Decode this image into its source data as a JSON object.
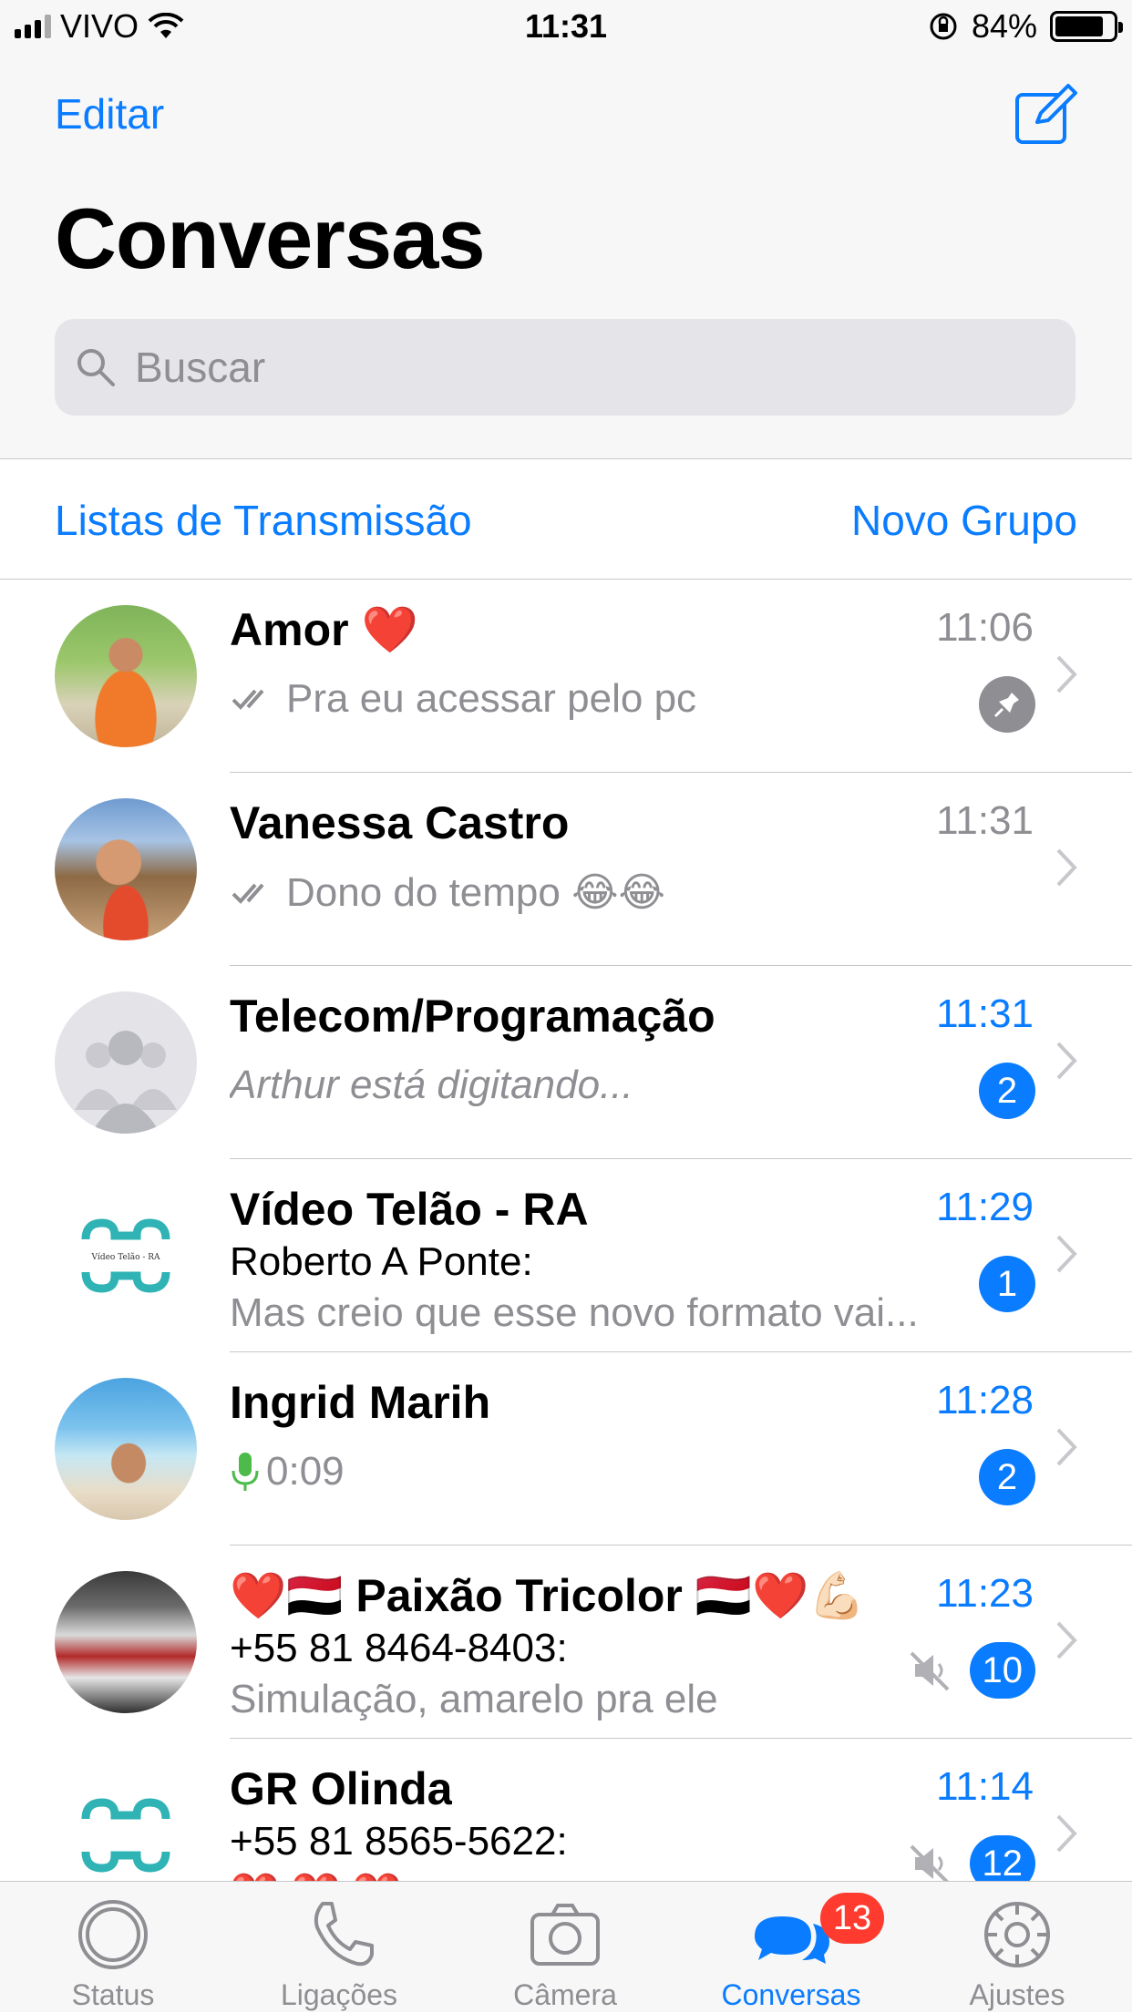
{
  "status_bar": {
    "carrier": "VIVO",
    "time": "11:31",
    "battery": "84%",
    "battery_level": 0.84
  },
  "header": {
    "edit_label": "Editar",
    "title": "Conversas",
    "search_placeholder": "Buscar"
  },
  "actions": {
    "broadcast_label": "Listas de Transmissão",
    "new_group_label": "Novo Grupo"
  },
  "chats": [
    {
      "name": "Amor ❤️",
      "time": "11:06",
      "preview": "Pra eu acessar pelo pc",
      "pinned": true
    },
    {
      "name": "Vanessa Castro",
      "time": "11:31",
      "preview": "Dono do tempo 😂😂"
    },
    {
      "name": "Telecom/Programação",
      "time": "11:31",
      "preview": "Arthur está digitando...",
      "unread": "2"
    },
    {
      "name": "Vídeo Telão - RA",
      "time": "11:29",
      "sender": "Roberto A Ponte:",
      "preview": "Mas creio que esse novo formato vai...",
      "unread": "1",
      "avatar_text": "Vídeo Telão - RA"
    },
    {
      "name": "Ingrid Marih",
      "time": "11:28",
      "preview": "0:09",
      "unread": "2"
    },
    {
      "name": "❤️🇾🇪 Paixão Tricolor 🇾🇪❤️💪🏻",
      "time": "11:23",
      "sender": "+55 81 8464-8403:",
      "preview": "Simulação, amarelo pra ele",
      "unread": "10",
      "muted": true
    },
    {
      "name": "GR Olinda",
      "time": "11:14",
      "sender": "+55 81 8565-5622:",
      "preview": "❤️ ❤️ ❤️",
      "unread": "12",
      "muted": true
    }
  ],
  "tabs": [
    {
      "label": "Status",
      "icon": "status-icon"
    },
    {
      "label": "Ligações",
      "icon": "phone-icon"
    },
    {
      "label": "Câmera",
      "icon": "camera-icon"
    },
    {
      "label": "Conversas",
      "icon": "chats-icon",
      "badge": "13",
      "active": true
    },
    {
      "label": "Ajustes",
      "icon": "settings-icon"
    }
  ],
  "colors": {
    "accent": "#0a7cff",
    "badge_red": "#ff3b30",
    "gray_text": "#8e8e93",
    "background": "#f7f7f7"
  }
}
